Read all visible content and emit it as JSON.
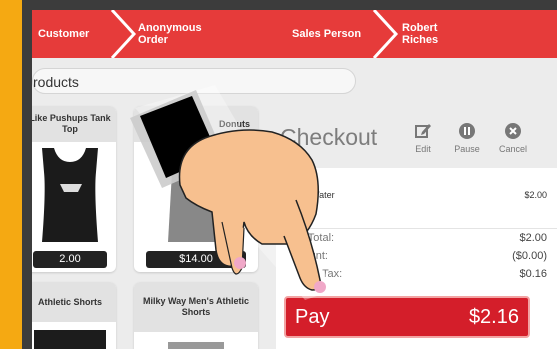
{
  "header": {
    "customer_label": "Customer",
    "customer_value": "Anonymous Order",
    "sales_person_label": "Sales Person",
    "sales_person_value": "Robert Riches"
  },
  "search": {
    "text": "roducts"
  },
  "products": [
    {
      "name": "Like Pushups Tank Top",
      "price": "2.00"
    },
    {
      "name": "Donuts",
      "price": "$14.00"
    },
    {
      "name": "Athletic Shorts",
      "price": ""
    },
    {
      "name": "Milky Way Men's Athletic Shorts",
      "price": ""
    }
  ],
  "checkout": {
    "title": "Checkout",
    "actions": {
      "edit": "Edit",
      "pause": "Pause",
      "cancel": "Cancel"
    },
    "item": {
      "name": "ert Water",
      "price": "$2.00"
    },
    "summary": [
      {
        "label": "b-Total:",
        "value": "$2.00"
      },
      {
        "label": "count:",
        "value": "($0.00)"
      },
      {
        "label": "Tax:",
        "value": "$0.16"
      }
    ],
    "pay": {
      "label": "Pay",
      "amount": "$2.16"
    }
  },
  "colors": {
    "header": "#e63b3a",
    "pay": "#d41e2a",
    "background": "#f5a912",
    "bezel": "#3c3c3c"
  }
}
